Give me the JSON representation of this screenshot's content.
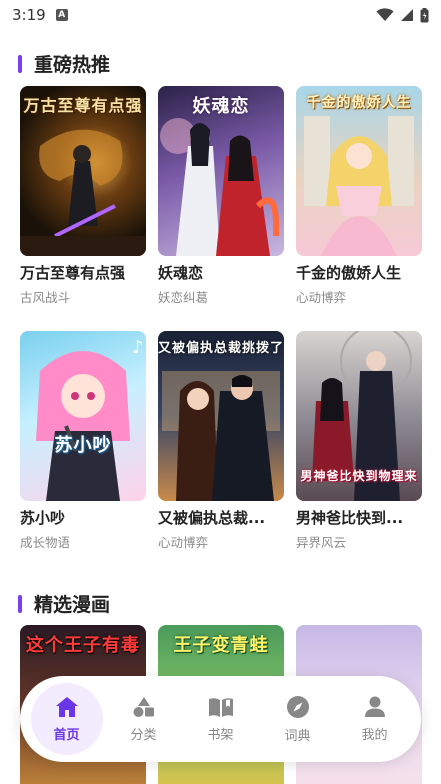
{
  "status": {
    "time": "3:19"
  },
  "sections": [
    {
      "title": "重磅热推",
      "books": [
        {
          "name": "万古至尊有点强",
          "tag": "古风战斗",
          "cover_text": "万古至尊有点强"
        },
        {
          "name": "妖魂恋",
          "tag": "妖恋纠葛",
          "cover_text": "妖魂恋"
        },
        {
          "name": "千金的傲娇人生",
          "tag": "心动博弈",
          "cover_text": "千金的傲娇人生"
        },
        {
          "name": "苏小吵",
          "tag": "成长物语",
          "cover_text": "苏小吵"
        },
        {
          "name": "又被偏执总裁...",
          "tag": "心动博弈",
          "cover_text": "又被偏执总裁挑拨了"
        },
        {
          "name": "男神爸比快到...",
          "tag": "异界风云",
          "cover_text": "男神爸比快到物理来"
        }
      ]
    },
    {
      "title": "精选漫画",
      "books": [
        {
          "cover_text": "这个王子有毒"
        },
        {
          "cover_text": "王子变青蛙"
        },
        {
          "cover_text": ""
        }
      ]
    }
  ],
  "nav": [
    {
      "label": "首页",
      "icon": "home-icon",
      "active": true
    },
    {
      "label": "分类",
      "icon": "category-icon",
      "active": false
    },
    {
      "label": "书架",
      "icon": "bookshelf-icon",
      "active": false
    },
    {
      "label": "词典",
      "icon": "compass-icon",
      "active": false
    },
    {
      "label": "我的",
      "icon": "profile-icon",
      "active": false
    }
  ],
  "colors": {
    "accent": "#7a3ff0",
    "nav_active": "#6b35e8",
    "nav_active_bg": "#f3ecff"
  }
}
